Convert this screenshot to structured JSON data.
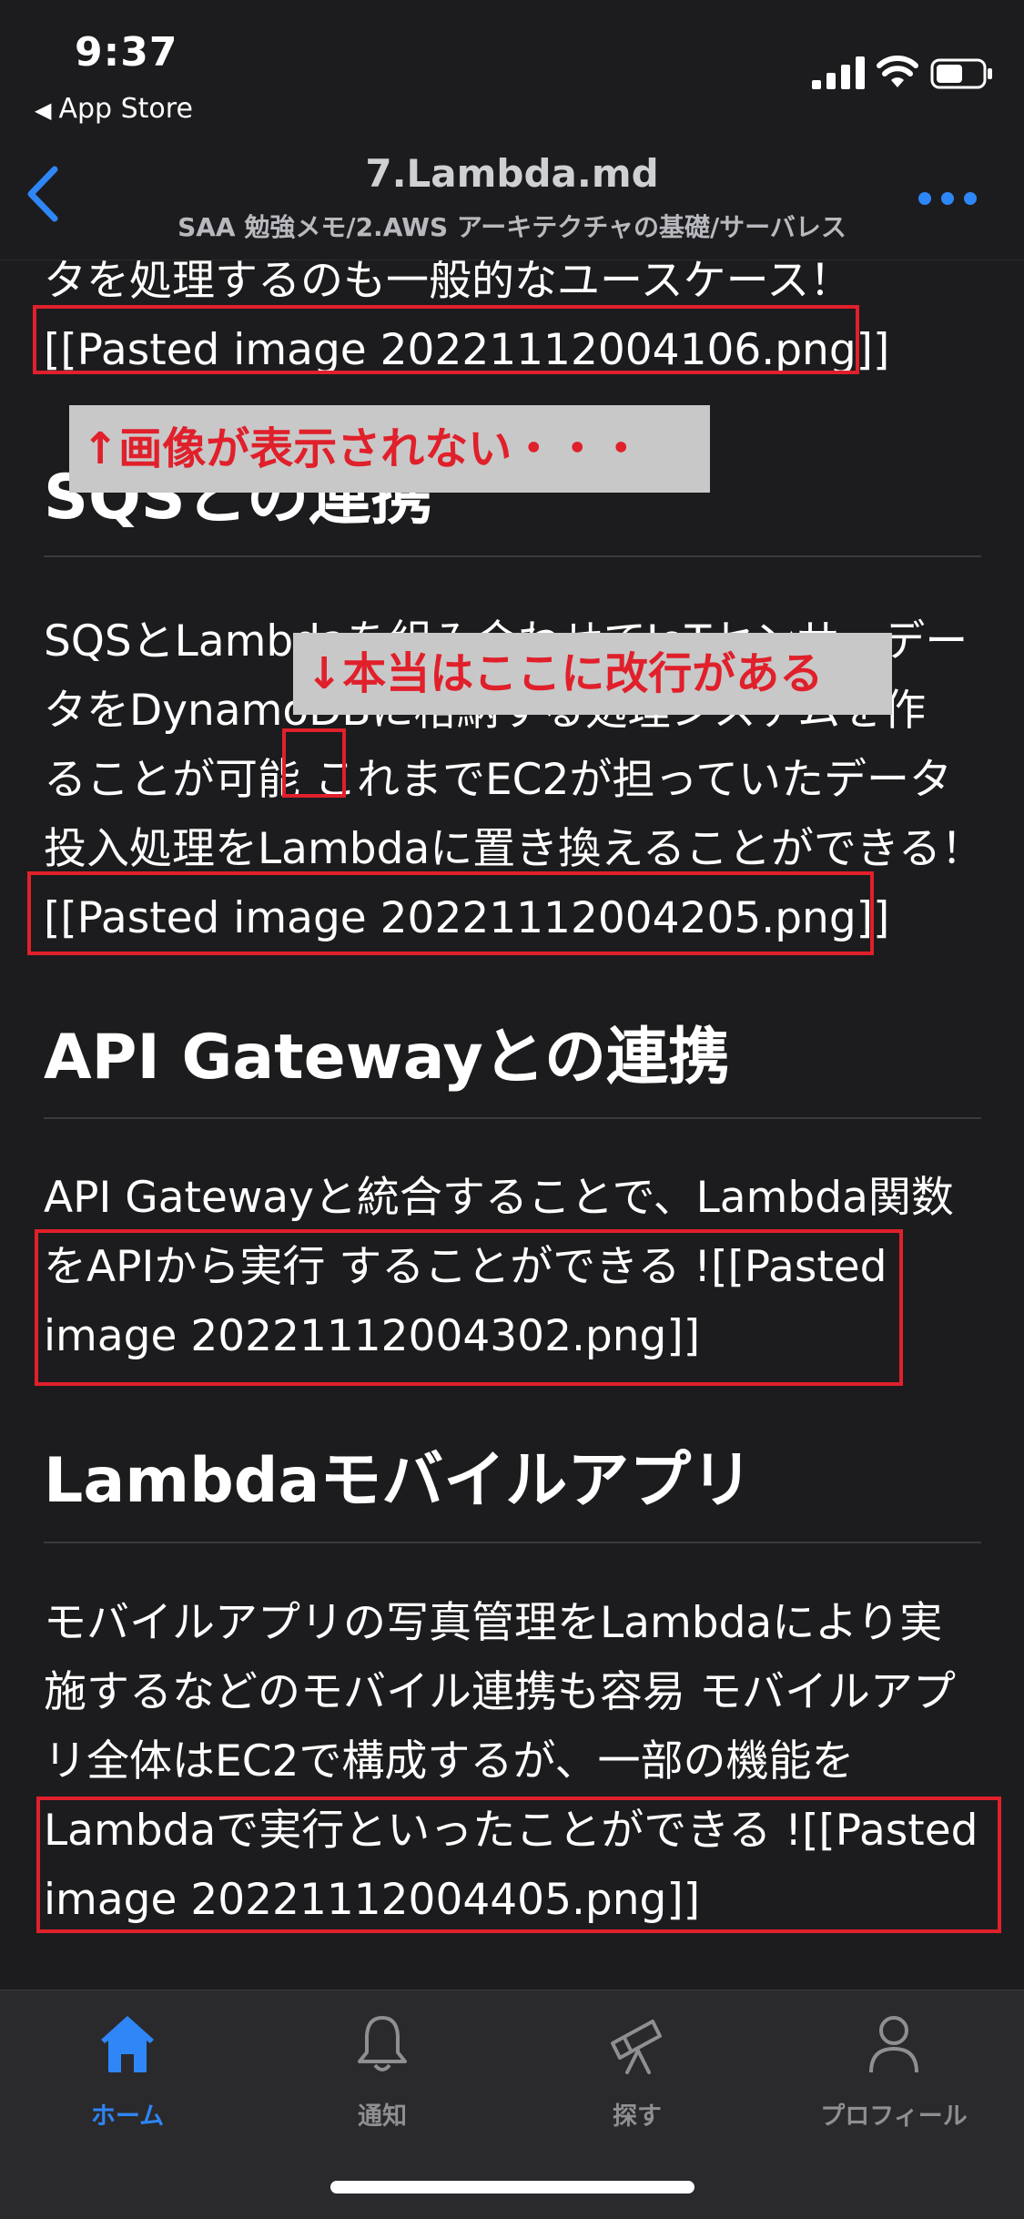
{
  "status": {
    "time": "9:37",
    "back_app": "App Store"
  },
  "nav": {
    "title": "7.Lambda.md",
    "subtitle": "SAA 勉強メモ/2.AWS アーキテクチャの基礎/サーバレス"
  },
  "content": {
    "intro_tail": "タを処理するのも一般的なユースケース！",
    "intro_image_link": "[[Pasted image 20221112004106.png]]",
    "sqs_heading": "SQSとの連携",
    "sqs_lines": [
      "SQSとLambdaを組み合わせてIoTセンサーデー",
      "タをDynamoDBに格納する処理システムを作",
      "ることが可能 これまでEC2が担っていたデータ",
      "投入処理をLambdaに置き換えることができる！"
    ],
    "sqs_image_link": "[[Pasted image 20221112004205.png]]",
    "apigw_heading": "API Gatewayとの連携",
    "apigw_lines": [
      "API Gatewayと統合することで、Lambda関数",
      "をAPIから実行 することができる ![[Pasted",
      "image 20221112004302.png]]"
    ],
    "mobile_heading": "Lambdaモバイルアプリ",
    "mobile_lines": [
      "モバイルアプリの写真管理をLambdaにより実",
      "施するなどのモバイル連携も容易 モバイルアプ",
      "リ全体はEC2で構成するが、一部の機能を",
      "Lambdaで実行といったことができる ![[Pasted",
      "image 20221112004405.png]]"
    ]
  },
  "annotations": {
    "image_not_shown": "↑画像が表示されない・・・",
    "newline_here": "↓本当はここに改行がある"
  },
  "tabs": [
    {
      "label": "ホーム",
      "icon": "home-icon",
      "active": true
    },
    {
      "label": "通知",
      "icon": "bell-icon",
      "active": false
    },
    {
      "label": "探す",
      "icon": "telescope-icon",
      "active": false
    },
    {
      "label": "プロフィール",
      "icon": "person-icon",
      "active": false
    }
  ],
  "colors": {
    "accent": "#2f86f6",
    "annotation_red": "#e0202b",
    "background": "#1c1c1e"
  }
}
